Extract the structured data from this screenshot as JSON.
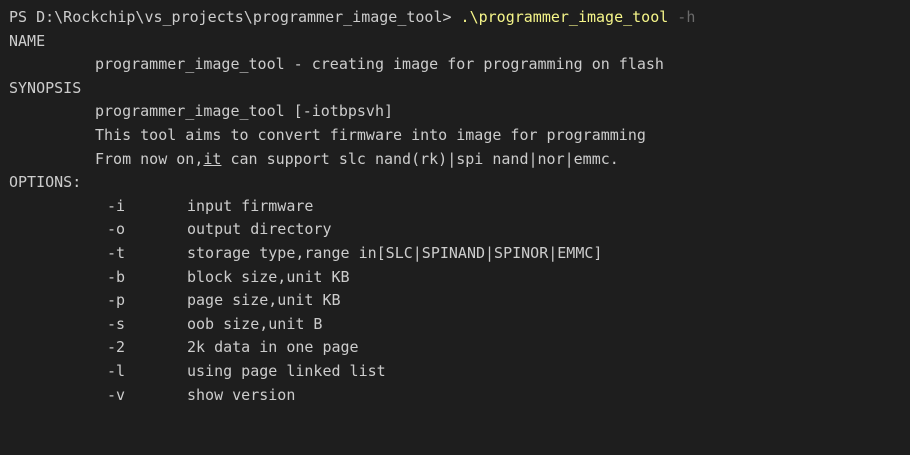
{
  "prompt": {
    "path": "PS D:\\Rockchip\\vs_projects\\programmer_image_tool> ",
    "command": ".\\programmer_image_tool",
    "flag": " -h"
  },
  "sections": {
    "name_header": "NAME",
    "name_line": "programmer_image_tool - creating image for programming on flash",
    "synopsis_header": "SYNOPSIS",
    "synopsis_line1": "programmer_image_tool [-iotbpsvh]",
    "synopsis_line2": "This tool aims to convert firmware into image for programming",
    "synopsis_line3_pre": "From now on,",
    "synopsis_line3_underlined": "it",
    "synopsis_line3_post": " can support slc nand(rk)|spi nand|nor|emmc.",
    "options_header": "OPTIONS:"
  },
  "options": [
    {
      "flag": "-i",
      "desc": "input firmware"
    },
    {
      "flag": "-o",
      "desc": "output directory"
    },
    {
      "flag": "-t",
      "desc": "storage type,range in[SLC|SPINAND|SPINOR|EMMC]"
    },
    {
      "flag": "-b",
      "desc": "block size,unit KB"
    },
    {
      "flag": "-p",
      "desc": "page size,unit KB"
    },
    {
      "flag": "-s",
      "desc": "oob size,unit B"
    },
    {
      "flag": "-2",
      "desc": "2k data in one page"
    },
    {
      "flag": "-l",
      "desc": "using page linked list"
    },
    {
      "flag": "-v",
      "desc": "show version"
    }
  ]
}
